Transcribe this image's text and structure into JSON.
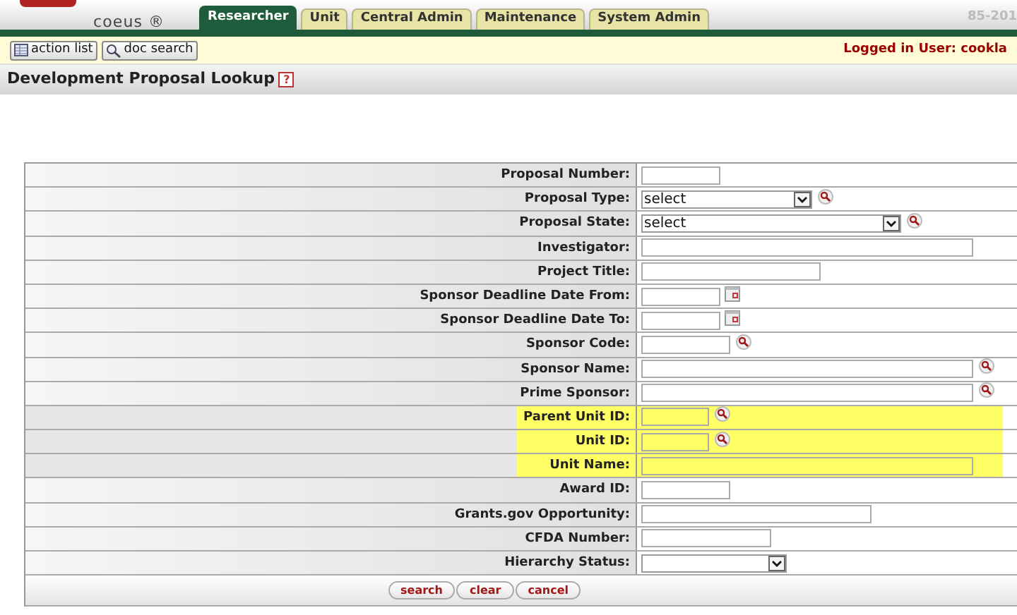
{
  "header": {
    "logo_text": "coeus ®",
    "version": "85-201",
    "tabs": [
      {
        "label": "Researcher",
        "selected": true
      },
      {
        "label": "Unit",
        "selected": false
      },
      {
        "label": "Central Admin",
        "selected": false
      },
      {
        "label": "Maintenance",
        "selected": false
      },
      {
        "label": "System Admin",
        "selected": false
      }
    ]
  },
  "toolbar": {
    "buttons": [
      "action list",
      "doc search"
    ],
    "logged_in": "Logged in User: cookla"
  },
  "page_title": "Development Proposal Lookup",
  "help_label": "?",
  "fields": [
    {
      "label": "Proposal Number:",
      "kind": "text",
      "lookup": false,
      "highlighted": false
    },
    {
      "label": "Proposal Type:",
      "kind": "select",
      "value": "select",
      "lookup": true,
      "highlighted": false
    },
    {
      "label": "Proposal State:",
      "kind": "select",
      "value": "select",
      "lookup": true,
      "highlighted": false
    },
    {
      "label": "Investigator:",
      "kind": "text",
      "lookup": false,
      "highlighted": false
    },
    {
      "label": "Project Title:",
      "kind": "text",
      "lookup": false,
      "highlighted": false
    },
    {
      "label": "Sponsor Deadline Date From:",
      "kind": "date",
      "lookup": false,
      "highlighted": false
    },
    {
      "label": "Sponsor Deadline Date To:",
      "kind": "date",
      "lookup": false,
      "highlighted": false
    },
    {
      "label": "Sponsor Code:",
      "kind": "text",
      "lookup": true,
      "highlighted": false
    },
    {
      "label": "Sponsor Name:",
      "kind": "text",
      "lookup": true,
      "highlighted": false
    },
    {
      "label": "Prime Sponsor:",
      "kind": "text",
      "lookup": true,
      "highlighted": false
    },
    {
      "label": "Parent Unit ID:",
      "kind": "text",
      "lookup": true,
      "highlighted": true
    },
    {
      "label": "Unit ID:",
      "kind": "text",
      "lookup": true,
      "highlighted": true
    },
    {
      "label": "Unit Name:",
      "kind": "text",
      "lookup": false,
      "highlighted": true
    },
    {
      "label": "Award ID:",
      "kind": "text",
      "lookup": false,
      "highlighted": false
    },
    {
      "label": "Grants.gov Opportunity:",
      "kind": "text",
      "lookup": false,
      "highlighted": false
    },
    {
      "label": "CFDA Number:",
      "kind": "text",
      "lookup": false,
      "highlighted": false
    },
    {
      "label": "Hierarchy Status:",
      "kind": "select",
      "lookup": false,
      "highlighted": false
    }
  ],
  "actions": [
    "search",
    "clear",
    "cancel"
  ]
}
